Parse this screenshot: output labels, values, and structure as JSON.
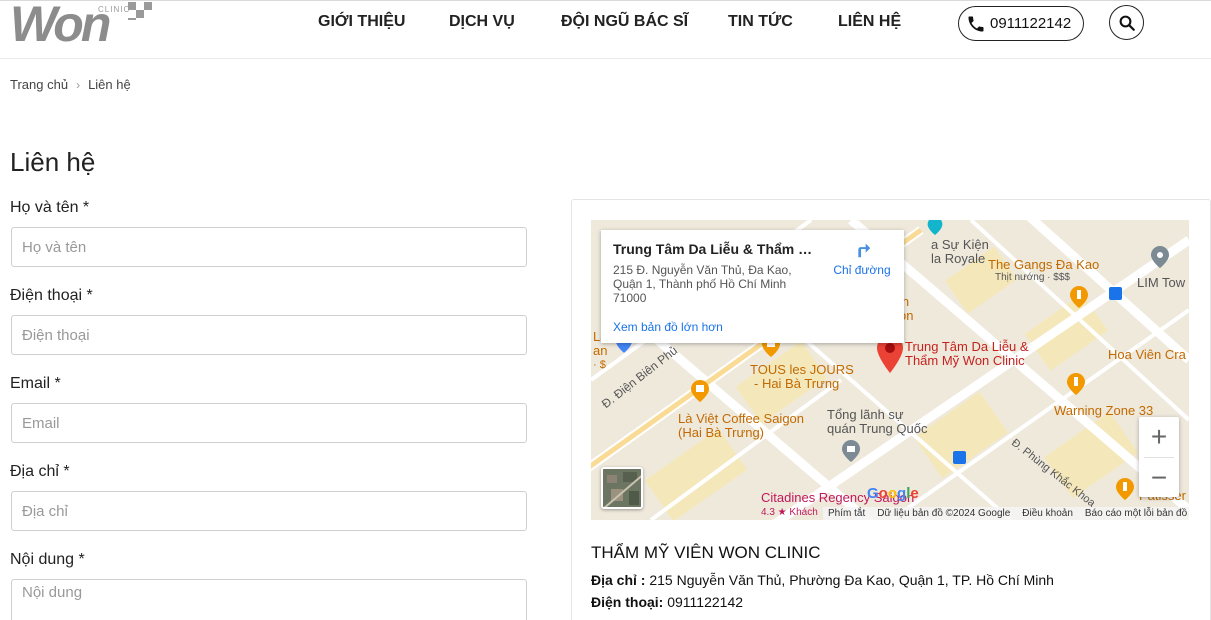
{
  "logo": {
    "brand": "Won",
    "sub": "CLINIC"
  },
  "nav": {
    "items": [
      "GIỚI THIỆU",
      "DỊCH VỤ",
      "ĐỘI NGŨ BÁC SĨ",
      "TIN TỨC",
      "LIÊN HỆ"
    ],
    "phone": "0911122142"
  },
  "breadcrumb": {
    "home": "Trang chủ",
    "current": "Liên hệ"
  },
  "form": {
    "title": "Liên hệ",
    "fields": [
      {
        "label": "Họ và tên *",
        "placeholder": "Họ và tên"
      },
      {
        "label": "Điện thoại *",
        "placeholder": "Điện thoại"
      },
      {
        "label": "Email *",
        "placeholder": "Email"
      },
      {
        "label": "Địa chỉ *",
        "placeholder": "Địa chỉ"
      },
      {
        "label": "Nội dung *",
        "placeholder": "Nội dung"
      }
    ]
  },
  "map": {
    "info": {
      "title": "Trung Tâm Da Liễu & Thẩm M...",
      "address": "215 Đ. Nguyễn Văn Thủ, Đa Kao, Quận 1, Thành phố Hồ Chí Minh 71000",
      "directions": "Chỉ đường",
      "larger_map": "Xem bản đồ lớn hơn"
    },
    "labels": {
      "su_kien": "a Sự Kiện",
      "royale": "la Royale",
      "gangs": "The Gangs Đa Kao",
      "thit_nuong": "Thịt nướng · $$$",
      "lim": "LIM Tow",
      "clinic_1": "Trung Tâm Da Liễu &",
      "clinic_2": "Thẩm Mỹ Won Clinic",
      "hoa_vien": "Hoa Viên Cra",
      "tous_1": "TOUS les JOURS",
      "tous_2": "- Hai Bà Trưng",
      "la_viet_1": "Là Việt Coffee Saigon",
      "la_viet_2": "(Hai Bà Trưng)",
      "tong_lanh_su_1": "Tổng lãnh sự",
      "tong_lanh_su_2": "quán Trung Quốc",
      "warning": "Warning Zone 33",
      "bien_phu": "Đ. Điện Biên Phủ",
      "phung_khac": "Đ. Phùng Khắc Khoa",
      "citadines": "Citadines Regency Saigon",
      "rating": "4.3 ★ Khách",
      "patisser": "Patisser",
      "in1": "in",
      "in2": "on",
      "la": "Là",
      "an": "an",
      "dollar": "· $"
    },
    "footer": {
      "shortcuts": "Phím tắt",
      "data": "Dữ liệu bản đồ ©2024 Google",
      "terms": "Điều khoản",
      "report": "Báo cáo một lỗi bản đồ"
    },
    "google": "Google"
  },
  "clinic": {
    "name": "THẨM MỸ VIÊN WON CLINIC",
    "address_label": "Địa chỉ :",
    "address": "215 Nguyễn Văn Thủ, Phường Đa Kao, Quận 1, TP. Hồ Chí Minh",
    "phone_label": "Điện thoại:",
    "phone": "0911122142"
  },
  "colors": {
    "pin_red": "#ea4335",
    "link_blue": "#1a73e8",
    "poi_orange": "#f29900"
  }
}
